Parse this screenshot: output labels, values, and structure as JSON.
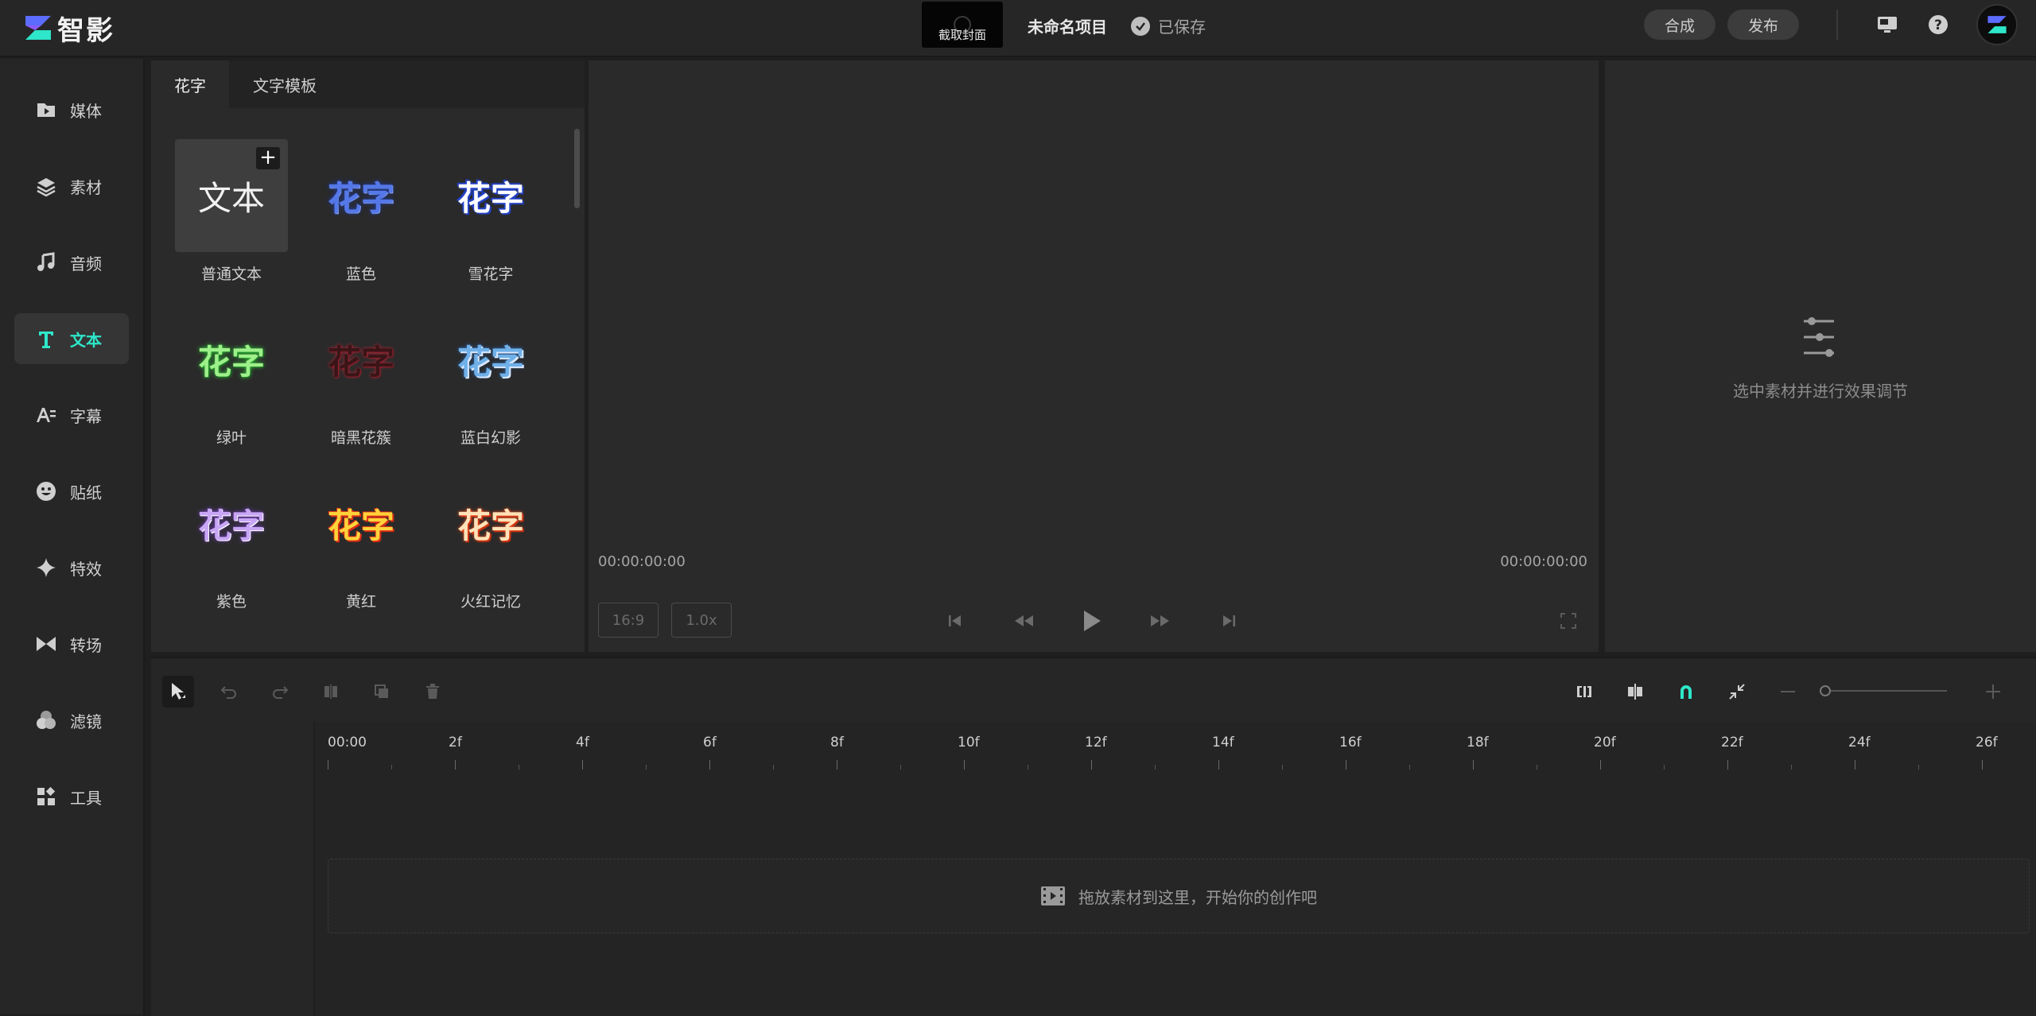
{
  "app": {
    "name": "智影",
    "project_title": "未命名项目",
    "saved_status": "已保存",
    "cover_label": "截取封面"
  },
  "header": {
    "compose_label": "合成",
    "publish_label": "发布"
  },
  "nav": {
    "items": [
      {
        "label": "媒体",
        "icon": "folder-icon"
      },
      {
        "label": "素材",
        "icon": "layers-icon"
      },
      {
        "label": "音频",
        "icon": "music-icon"
      },
      {
        "label": "文本",
        "icon": "text-icon",
        "active": true
      },
      {
        "label": "字幕",
        "icon": "subtitle-icon"
      },
      {
        "label": "贴纸",
        "icon": "sticker-icon"
      },
      {
        "label": "特效",
        "icon": "sparkle-icon"
      },
      {
        "label": "转场",
        "icon": "transition-icon"
      },
      {
        "label": "滤镜",
        "icon": "filter-icon"
      },
      {
        "label": "工具",
        "icon": "tools-icon"
      }
    ]
  },
  "panel": {
    "tabs": [
      {
        "label": "花字"
      },
      {
        "label": "文字模板"
      }
    ],
    "cards": [
      {
        "preview": "文本",
        "label": "普通文本"
      },
      {
        "preview": "花字",
        "label": "蓝色"
      },
      {
        "preview": "花字",
        "label": "雪花字"
      },
      {
        "preview": "花字",
        "label": "绿叶"
      },
      {
        "preview": "花字",
        "label": "暗黑花簇"
      },
      {
        "preview": "花字",
        "label": "蓝白幻影"
      },
      {
        "preview": "花字",
        "label": "紫色"
      },
      {
        "preview": "花字",
        "label": "黄红"
      },
      {
        "preview": "花字",
        "label": "火红记忆"
      }
    ]
  },
  "preview": {
    "time_current": "00:00:00:00",
    "time_total": "00:00:00:00",
    "ratio": "16:9",
    "speed": "1.0x"
  },
  "props": {
    "hint": "选中素材并进行效果调节"
  },
  "timeline": {
    "ticks": [
      "00:00",
      "2f",
      "4f",
      "6f",
      "8f",
      "10f",
      "12f",
      "14f",
      "16f",
      "18f",
      "20f",
      "22f",
      "24f",
      "26f"
    ],
    "drop_hint": "拖放素材到这里，开始你的创作吧"
  },
  "colors": {
    "accent": "#2ee6c9"
  }
}
